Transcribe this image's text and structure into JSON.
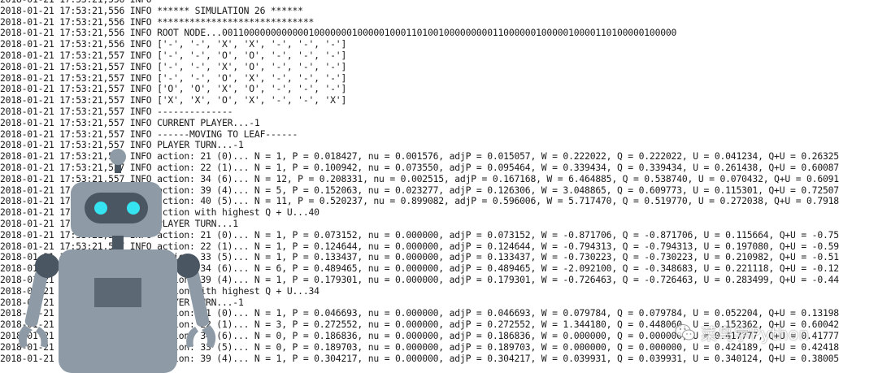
{
  "terminal": {
    "background": "#ffffff",
    "text_color": "#1a1a1a",
    "lines": [
      "2018-01-21 17:53:21,556 INFO *****************************",
      "2018-01-21 17:53:21,556 INFO ****** SIMULATION 26 ******",
      "2018-01-21 17:53:21,556 INFO *****************************",
      "2018-01-21 17:53:21,556 INFO ROOT NODE...001100000000000010000000100000100011010010000000001100000010000010000110100000100000",
      "2018-01-21 17:53:21,556 INFO ['-', '-', 'X', 'X', '-', '-', '-']",
      "2018-01-21 17:53:21,557 INFO ['-', '-', 'O', 'O', '-', '-', '-']",
      "2018-01-21 17:53:21,557 INFO ['-', '-', 'X', 'O', '-', '-', '-']",
      "2018-01-21 17:53:21,557 INFO ['-', '-', 'O', 'X', '-', '-', '-']",
      "2018-01-21 17:53:21,557 INFO ['O', 'O', 'X', 'O', '-', '-', '-']",
      "2018-01-21 17:53:21,557 INFO ['X', 'X', 'O', 'X', '-', '-', 'X']",
      "2018-01-21 17:53:21,557 INFO --------------",
      "2018-01-21 17:53:21,557 INFO CURRENT PLAYER...-1",
      "2018-01-21 17:53:21,557 INFO ------MOVING TO LEAF------",
      "2018-01-21 17:53:21,557 INFO PLAYER TURN...-1",
      "2018-01-21 17:53:21,557 INFO action: 21 (0)... N = 1, P = 0.018427, nu = 0.001576, adjP = 0.015057, W = 0.222022, Q = 0.222022, U = 0.041234, Q+U = 0.26325",
      "2018-01-21 17:53:21,557 INFO action: 22 (1)... N = 1, P = 0.100942, nu = 0.073550, adjP = 0.095464, W = 0.339434, Q = 0.339434, U = 0.261438, Q+U = 0.60087",
      "2018-01-21 17:53:21,557 INFO action: 34 (6)... N = 12, P = 0.208331, nu = 0.002515, adjP = 0.167168, W = 6.464885, Q = 0.538740, U = 0.070432, Q+U = 0.6091",
      "2018-01-21 17:53:21,557 INFO action: 39 (4)... N = 5, P = 0.152063, nu = 0.023277, adjP = 0.126306, W = 3.048865, Q = 0.609773, U = 0.115301, Q+U = 0.72507",
      "2018-01-21 17:53:21,557 INFO action: 40 (5)... N = 11, P = 0.520237, nu = 0.899082, adjP = 0.596006, W = 5.717470, Q = 0.519770, U = 0.272038, Q+U = 0.7918",
      "2018-01-21 17:53:21,557 INFO action with highest Q + U...40",
      "2018-01-21 17:53:21,557 INFO PLAYER TURN...1",
      "2018-01-21 17:53:21,557 INFO action: 21 (0)... N = 1, P = 0.073152, nu = 0.000000, adjP = 0.073152, W = -0.871706, Q = -0.871706, U = 0.115664, Q+U = -0.75",
      "2018-01-21 17:53:21,557 INFO action: 22 (1)... N = 1, P = 0.124644, nu = 0.000000, adjP = 0.124644, W = -0.794313, Q = -0.794313, U = 0.197080, Q+U = -0.59",
      "2018-01-21 17:53:21,557 INFO action: 33 (5)... N = 1, P = 0.133437, nu = 0.000000, adjP = 0.133437, W = -0.730223, Q = -0.730223, U = 0.210982, Q+U = -0.51",
      "2018-01-21 17:53:21,557 INFO action: 34 (6)... N = 6, P = 0.489465, nu = 0.000000, adjP = 0.489465, W = -2.092100, Q = -0.348683, U = 0.221118, Q+U = -0.12",
      "2018-01-21 17:53:21,557 INFO action: 39 (4)... N = 1, P = 0.179301, nu = 0.000000, adjP = 0.179301, W = -0.726463, Q = -0.726463, U = 0.283499, Q+U = -0.44",
      "2018-01-21 17:53:21,557 INFO action with highest Q + U...34",
      "2018-01-21 17:53:21,557 INFO PLAYER TURN...-1",
      "2018-01-21 17:53:21,557 INFO action: 21 (0)... N = 1, P = 0.046693, nu = 0.000000, adjP = 0.046693, W = 0.079784, Q = 0.079784, U = 0.052204, Q+U = 0.13198",
      "2018-01-21 17:53:21,557 INFO action: 22 (1)... N = 3, P = 0.272552, nu = 0.000000, adjP = 0.272552, W = 1.344180, Q = 0.448060, U = 0.152362, Q+U = 0.60042",
      "2018-01-21 17:53:21,557 INFO action: 34 (6)... N = 0, P = 0.186836, nu = 0.000000, adjP = 0.186836, W = 0.000000, Q = 0.000000, U = 0.417777, Q+U = 0.41777",
      "2018-01-21 17:53:21,557 INFO action: 33 (5)... N = 0, P = 0.189703, nu = 0.000000, adjP = 0.189703, W = 0.000000, Q = 0.000000, U = 0.424189, Q+U = 0.42418",
      "2018-01-21 17:53:21,557 INFO action: 39 (4)... N = 1, P = 0.304217, nu = 0.000000, adjP = 0.304217, W = 0.039931, Q = 0.039931, U = 0.340124, Q+U = 0.38005"
    ]
  },
  "overlay": {
    "robot": {
      "icon": "robot-mascot-icon",
      "body_color": "#8e9ba6",
      "dark_color": "#4a5661",
      "eye_color": "#35e4f0"
    },
    "watermark": {
      "icon": "wechat-icon",
      "text": "菜鸟学Python"
    }
  }
}
